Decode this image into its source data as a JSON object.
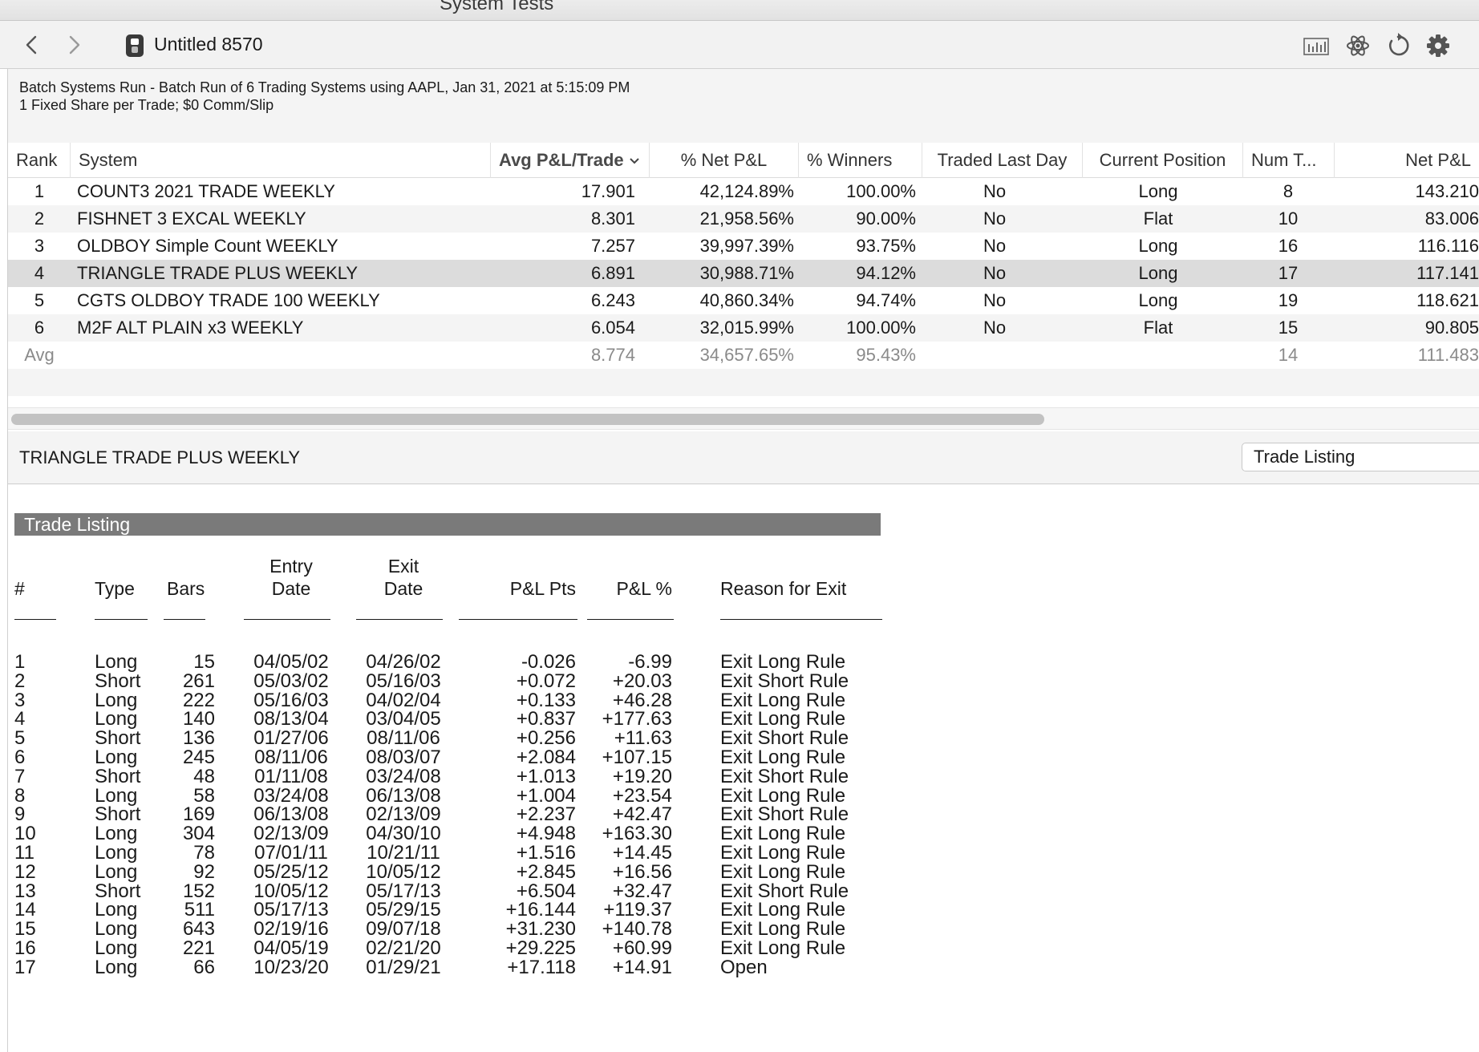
{
  "window": {
    "title": "System Tests",
    "document_title": "Untitled 8570"
  },
  "toolbar": {
    "icons": [
      "chevron-left-icon",
      "chevron-right-icon",
      "document-icon",
      "bar-chart-icon",
      "atom-icon",
      "refresh-icon",
      "gear-icon"
    ]
  },
  "info": {
    "line1": "Batch Systems Run - Batch Run of 6 Trading Systems using AAPL, Jan 31, 2021 at 5:15:09 PM",
    "line2": "1 Fixed Share per Trade; $0 Comm/Slip"
  },
  "ranking": {
    "columns": {
      "rank": "Rank",
      "system": "System",
      "avg_pnl": "Avg P&L/Trade",
      "pct_net": "% Net P&L",
      "pct_win": "% Winners",
      "traded_last": "Traded Last Day",
      "current_pos": "Current Position",
      "num_trades": "Num T...",
      "net_pnl": "Net P&L"
    },
    "rows": [
      {
        "rank": "1",
        "system": "COUNT3 2021 TRADE WEEKLY",
        "avg_pnl": "17.901",
        "pct_net": "42,124.89%",
        "pct_win": "100.00%",
        "traded_last": "No",
        "current_pos": "Long",
        "num_trades": "8",
        "net_pnl": "143.210"
      },
      {
        "rank": "2",
        "system": "FISHNET 3 EXCAL WEEKLY",
        "avg_pnl": "8.301",
        "pct_net": "21,958.56%",
        "pct_win": "90.00%",
        "traded_last": "No",
        "current_pos": "Flat",
        "num_trades": "10",
        "net_pnl": "83.006"
      },
      {
        "rank": "3",
        "system": "OLDBOY Simple Count WEEKLY",
        "avg_pnl": "7.257",
        "pct_net": "39,997.39%",
        "pct_win": "93.75%",
        "traded_last": "No",
        "current_pos": "Long",
        "num_trades": "16",
        "net_pnl": "116.116"
      },
      {
        "rank": "4",
        "system": "TRIANGLE TRADE PLUS WEEKLY",
        "avg_pnl": "6.891",
        "pct_net": "30,988.71%",
        "pct_win": "94.12%",
        "traded_last": "No",
        "current_pos": "Long",
        "num_trades": "17",
        "net_pnl": "117.141"
      },
      {
        "rank": "5",
        "system": "CGTS OLDBOY TRADE 100 WEEKLY",
        "avg_pnl": "6.243",
        "pct_net": "40,860.34%",
        "pct_win": "94.74%",
        "traded_last": "No",
        "current_pos": "Long",
        "num_trades": "19",
        "net_pnl": "118.621"
      },
      {
        "rank": "6",
        "system": "M2F ALT PLAIN x3 WEEKLY",
        "avg_pnl": "6.054",
        "pct_net": "32,015.99%",
        "pct_win": "100.00%",
        "traded_last": "No",
        "current_pos": "Flat",
        "num_trades": "15",
        "net_pnl": "90.805"
      }
    ],
    "avg_row": {
      "rank": "Avg",
      "avg_pnl": "8.774",
      "pct_net": "34,657.65%",
      "pct_win": "95.43%",
      "num_trades": "14",
      "net_pnl": "111.483"
    }
  },
  "detail": {
    "system_name": "TRIANGLE TRADE PLUS WEEKLY",
    "view_select": "Trade Listing"
  },
  "report": {
    "banner": "Trade Listing",
    "headers": {
      "num": "#",
      "type": "Type",
      "bars": "Bars",
      "entry_1": "Entry",
      "entry_2": "Date",
      "exit_1": "Exit",
      "exit_2": "Date",
      "pts": "P&L Pts",
      "pct": "P&L %",
      "reason": "Reason for Exit"
    },
    "trades": [
      {
        "num": "1",
        "type": "Long",
        "bars": "15",
        "entry": "04/05/02",
        "exit": "04/26/02",
        "pts": "-0.026",
        "pct": "-6.99",
        "reason": "Exit Long Rule"
      },
      {
        "num": "2",
        "type": "Short",
        "bars": "261",
        "entry": "05/03/02",
        "exit": "05/16/03",
        "pts": "+0.072",
        "pct": "+20.03",
        "reason": "Exit Short Rule"
      },
      {
        "num": "3",
        "type": "Long",
        "bars": "222",
        "entry": "05/16/03",
        "exit": "04/02/04",
        "pts": "+0.133",
        "pct": "+46.28",
        "reason": "Exit Long Rule"
      },
      {
        "num": "4",
        "type": "Long",
        "bars": "140",
        "entry": "08/13/04",
        "exit": "03/04/05",
        "pts": "+0.837",
        "pct": "+177.63",
        "reason": "Exit Long Rule"
      },
      {
        "num": "5",
        "type": "Short",
        "bars": "136",
        "entry": "01/27/06",
        "exit": "08/11/06",
        "pts": "+0.256",
        "pct": "+11.63",
        "reason": "Exit Short Rule"
      },
      {
        "num": "6",
        "type": "Long",
        "bars": "245",
        "entry": "08/11/06",
        "exit": "08/03/07",
        "pts": "+2.084",
        "pct": "+107.15",
        "reason": "Exit Long Rule"
      },
      {
        "num": "7",
        "type": "Short",
        "bars": "48",
        "entry": "01/11/08",
        "exit": "03/24/08",
        "pts": "+1.013",
        "pct": "+19.20",
        "reason": "Exit Short Rule"
      },
      {
        "num": "8",
        "type": "Long",
        "bars": "58",
        "entry": "03/24/08",
        "exit": "06/13/08",
        "pts": "+1.004",
        "pct": "+23.54",
        "reason": "Exit Long Rule"
      },
      {
        "num": "9",
        "type": "Short",
        "bars": "169",
        "entry": "06/13/08",
        "exit": "02/13/09",
        "pts": "+2.237",
        "pct": "+42.47",
        "reason": "Exit Short Rule"
      },
      {
        "num": "10",
        "type": "Long",
        "bars": "304",
        "entry": "02/13/09",
        "exit": "04/30/10",
        "pts": "+4.948",
        "pct": "+163.30",
        "reason": "Exit Long Rule"
      },
      {
        "num": "11",
        "type": "Long",
        "bars": "78",
        "entry": "07/01/11",
        "exit": "10/21/11",
        "pts": "+1.516",
        "pct": "+14.45",
        "reason": "Exit Long Rule"
      },
      {
        "num": "12",
        "type": "Long",
        "bars": "92",
        "entry": "05/25/12",
        "exit": "10/05/12",
        "pts": "+2.845",
        "pct": "+16.56",
        "reason": "Exit Long Rule"
      },
      {
        "num": "13",
        "type": "Short",
        "bars": "152",
        "entry": "10/05/12",
        "exit": "05/17/13",
        "pts": "+6.504",
        "pct": "+32.47",
        "reason": "Exit Short Rule"
      },
      {
        "num": "14",
        "type": "Long",
        "bars": "511",
        "entry": "05/17/13",
        "exit": "05/29/15",
        "pts": "+16.144",
        "pct": "+119.37",
        "reason": "Exit Long Rule"
      },
      {
        "num": "15",
        "type": "Long",
        "bars": "643",
        "entry": "02/19/16",
        "exit": "09/07/18",
        "pts": "+31.230",
        "pct": "+140.78",
        "reason": "Exit Long Rule"
      },
      {
        "num": "16",
        "type": "Long",
        "bars": "221",
        "entry": "04/05/19",
        "exit": "02/21/20",
        "pts": "+29.225",
        "pct": "+60.99",
        "reason": "Exit Long Rule"
      },
      {
        "num": "17",
        "type": "Long",
        "bars": "66",
        "entry": "10/23/20",
        "exit": "01/29/21",
        "pts": "+17.118",
        "pct": "+14.91",
        "reason": "Open"
      }
    ]
  },
  "colors": {
    "selected_row": "#dcdcdc",
    "banner_bg": "#7a7a7a",
    "avg_text": "#8a8a8a"
  }
}
